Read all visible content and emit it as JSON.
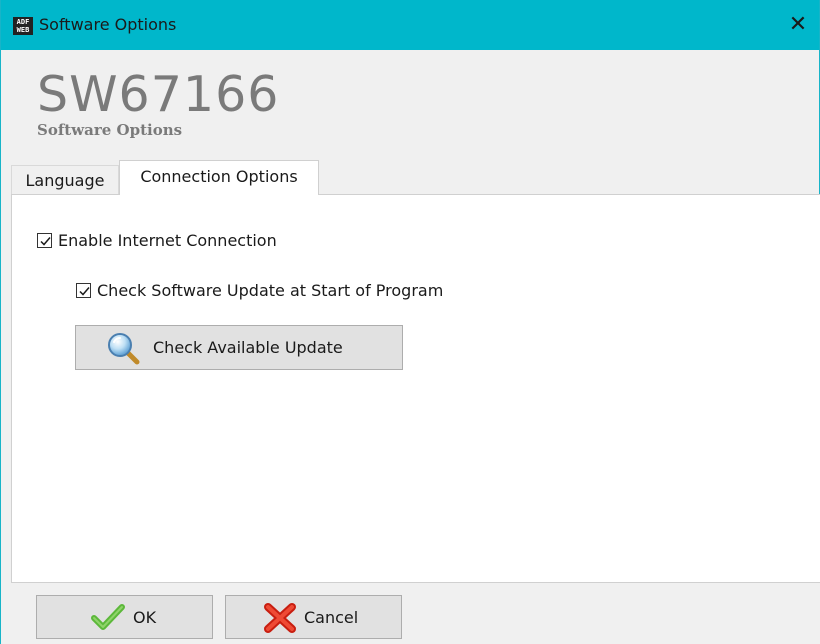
{
  "window": {
    "title": "Software Options",
    "app_icon_text": "ADF WEB",
    "close_glyph": "✕",
    "title_bar_color": "#00b7cb"
  },
  "header": {
    "product_code": "SW67166",
    "subtitle": "Software Options"
  },
  "tabs": [
    {
      "label": "Language",
      "selected": false
    },
    {
      "label": "Connection Options",
      "selected": true
    }
  ],
  "connection": {
    "enable_internet": {
      "label": "Enable Internet Connection",
      "checked": true
    },
    "check_update_start": {
      "label": "Check Software Update at Start of Program",
      "checked": true
    },
    "check_available_button": {
      "label": "Check Available Update",
      "icon": "magnifier-icon"
    }
  },
  "footer": {
    "ok": {
      "label": "OK",
      "icon": "check-icon",
      "icon_color": "#5cb83a"
    },
    "cancel": {
      "label": "Cancel",
      "icon": "red-x-icon",
      "icon_color": "#e03020"
    }
  }
}
